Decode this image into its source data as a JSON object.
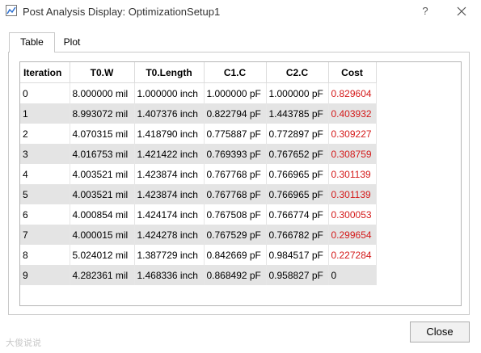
{
  "window": {
    "title": "Post Analysis Display: OptimizationSetup1",
    "help_label": "?"
  },
  "tabs": [
    {
      "label": "Table",
      "active": true
    },
    {
      "label": "Plot",
      "active": false
    }
  ],
  "table": {
    "columns": [
      "Iteration",
      "T0.W",
      "T0.Length",
      "C1.C",
      "C2.C",
      "Cost"
    ],
    "rows": [
      [
        "0",
        "8.000000 mil",
        "1.000000 inch",
        "1.000000 pF",
        "1.000000 pF",
        "0.829604"
      ],
      [
        "1",
        "8.993072 mil",
        "1.407376 inch",
        "0.822794 pF",
        "1.443785 pF",
        "0.403932"
      ],
      [
        "2",
        "4.070315 mil",
        "1.418790 inch",
        "0.775887 pF",
        "0.772897 pF",
        "0.309227"
      ],
      [
        "3",
        "4.016753 mil",
        "1.421422 inch",
        "0.769393 pF",
        "0.767652 pF",
        "0.308759"
      ],
      [
        "4",
        "4.003521 mil",
        "1.423874 inch",
        "0.767768 pF",
        "0.766965 pF",
        "0.301139"
      ],
      [
        "5",
        "4.003521 mil",
        "1.423874 inch",
        "0.767768 pF",
        "0.766965 pF",
        "0.301139"
      ],
      [
        "6",
        "4.000854 mil",
        "1.424174 inch",
        "0.767508 pF",
        "0.766774 pF",
        "0.300053"
      ],
      [
        "7",
        "4.000015 mil",
        "1.424278 inch",
        "0.767529 pF",
        "0.766782 pF",
        "0.299654"
      ],
      [
        "8",
        "5.024012 mil",
        "1.387729 inch",
        "0.842669 pF",
        "0.984517 pF",
        "0.227284"
      ],
      [
        "9",
        "4.282361 mil",
        "1.468336 inch",
        "0.868492 pF",
        "0.958827 pF",
        "0"
      ]
    ]
  },
  "buttons": {
    "close_label": "Close"
  },
  "watermark": "大俊说说",
  "colors": {
    "cost_text": "#d41a1a",
    "alt_row": "#e4e4e4"
  }
}
